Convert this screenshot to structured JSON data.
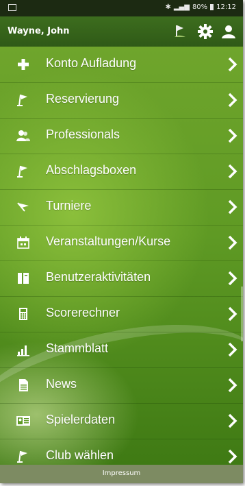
{
  "status_bar": {
    "battery": "80%",
    "time": "12:12"
  },
  "header": {
    "user_name": "Wayne, John"
  },
  "menu": {
    "items": [
      {
        "label": "Konto Aufladung",
        "icon": "plus-icon"
      },
      {
        "label": "Reservierung",
        "icon": "golf-flag-icon"
      },
      {
        "label": "Professionals",
        "icon": "users-icon"
      },
      {
        "label": "Abschlagsboxen",
        "icon": "golf-flag-icon"
      },
      {
        "label": "Turniere",
        "icon": "pennant-flag-icon"
      },
      {
        "label": "Veranstaltungen/Kurse",
        "icon": "calendar-icon"
      },
      {
        "label": "Benutzeraktivitäten",
        "icon": "book-icon"
      },
      {
        "label": "Scorerechner",
        "icon": "calculator-icon"
      },
      {
        "label": "Stammblatt",
        "icon": "bar-chart-icon"
      },
      {
        "label": "News",
        "icon": "document-icon"
      },
      {
        "label": "Spielerdaten",
        "icon": "id-card-icon"
      },
      {
        "label": "Club wählen",
        "icon": "golf-flag-icon"
      }
    ]
  },
  "footer": {
    "label": "Impressum"
  },
  "colors": {
    "header": "#2f5a17",
    "menu_bg": "#6fa52c",
    "footer": "#7d8b62",
    "text": "#ffffff"
  }
}
